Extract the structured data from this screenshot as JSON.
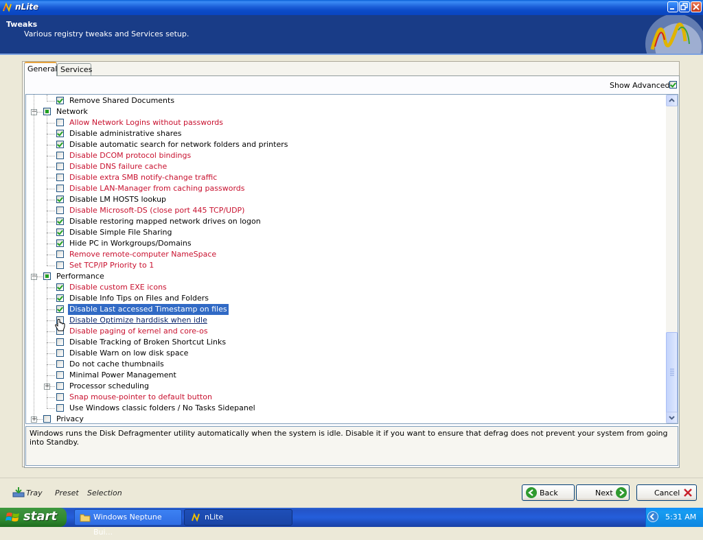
{
  "window": {
    "title": "nLite"
  },
  "header": {
    "title": "Tweaks",
    "subtitle": "Various registry tweaks and Services setup."
  },
  "tabs": [
    {
      "label": "General",
      "active": true
    },
    {
      "label": "Services",
      "active": false
    }
  ],
  "show_advanced": {
    "label": "Show Advanced",
    "checked": true
  },
  "tree": {
    "items": [
      {
        "label": "Remove Shared Documents",
        "checked": true,
        "color": "black"
      },
      {
        "label": "Network",
        "group": true,
        "state": "partial"
      },
      {
        "label": "Allow Network Logins without passwords",
        "checked": false,
        "color": "red"
      },
      {
        "label": "Disable administrative shares",
        "checked": true,
        "color": "black"
      },
      {
        "label": "Disable automatic search for network folders and printers",
        "checked": true,
        "color": "black"
      },
      {
        "label": "Disable DCOM protocol bindings",
        "checked": false,
        "color": "red"
      },
      {
        "label": "Disable DNS failure cache",
        "checked": false,
        "color": "red"
      },
      {
        "label": "Disable extra SMB notify-change traffic",
        "checked": false,
        "color": "red"
      },
      {
        "label": "Disable LAN-Manager from caching passwords",
        "checked": false,
        "color": "red"
      },
      {
        "label": "Disable LM HOSTS lookup",
        "checked": true,
        "color": "black"
      },
      {
        "label": "Disable Microsoft-DS (close port 445 TCP/UDP)",
        "checked": false,
        "color": "red"
      },
      {
        "label": "Disable restoring mapped network drives on logon",
        "checked": true,
        "color": "black"
      },
      {
        "label": "Disable Simple File Sharing",
        "checked": true,
        "color": "black"
      },
      {
        "label": "Hide PC in Workgroups/Domains",
        "checked": true,
        "color": "black"
      },
      {
        "label": "Remove remote-computer NameSpace",
        "checked": false,
        "color": "red"
      },
      {
        "label": "Set TCP/IP Priority to 1",
        "checked": false,
        "color": "red"
      },
      {
        "label": "Performance",
        "group": true,
        "state": "partial"
      },
      {
        "label": "Disable custom EXE icons",
        "checked": true,
        "color": "red"
      },
      {
        "label": "Disable Info Tips on Files and Folders",
        "checked": true,
        "color": "black"
      },
      {
        "label": "Disable Last accessed Timestamp on files",
        "checked": true,
        "color": "black",
        "selected": true
      },
      {
        "label": "Disable Optimize harddisk when idle",
        "checked": false,
        "color": "black",
        "hover": true
      },
      {
        "label": "Disable paging of kernel and core-os",
        "checked": false,
        "color": "red"
      },
      {
        "label": "Disable Tracking of Broken Shortcut Links",
        "checked": false,
        "color": "black"
      },
      {
        "label": "Disable Warn on low disk space",
        "checked": false,
        "color": "black"
      },
      {
        "label": "Do not cache thumbnails",
        "checked": false,
        "color": "black"
      },
      {
        "label": "Minimal Power Management",
        "checked": false,
        "color": "black"
      },
      {
        "label": "Processor scheduling",
        "checked": false,
        "color": "black",
        "expandable": true
      },
      {
        "label": "Snap mouse-pointer to default button",
        "checked": false,
        "color": "red"
      },
      {
        "label": "Use Windows classic folders / No Tasks Sidepanel",
        "checked": false,
        "color": "black"
      },
      {
        "label": "Privacy",
        "group": true,
        "state": "unchecked",
        "collapsed": true
      }
    ]
  },
  "description": "Windows runs the Disk Defragmenter utility automatically when the system is idle. Disable it if you want to ensure that defrag does not prevent your system from going into Standby.",
  "footer": {
    "tray_label": "Tray",
    "preset_label": "Preset",
    "selection_label": "Selection",
    "back_label": "Back",
    "next_label": "Next",
    "cancel_label": "Cancel"
  },
  "taskbar": {
    "start_label": "start",
    "tasks": [
      {
        "label": "Windows Neptune Bui...",
        "active": false
      },
      {
        "label": "nLite",
        "active": true
      }
    ],
    "clock": "5:31 AM"
  },
  "colors": {
    "accent": "#193c87",
    "red_item": "#c8102e",
    "selection": "#316ac5"
  }
}
